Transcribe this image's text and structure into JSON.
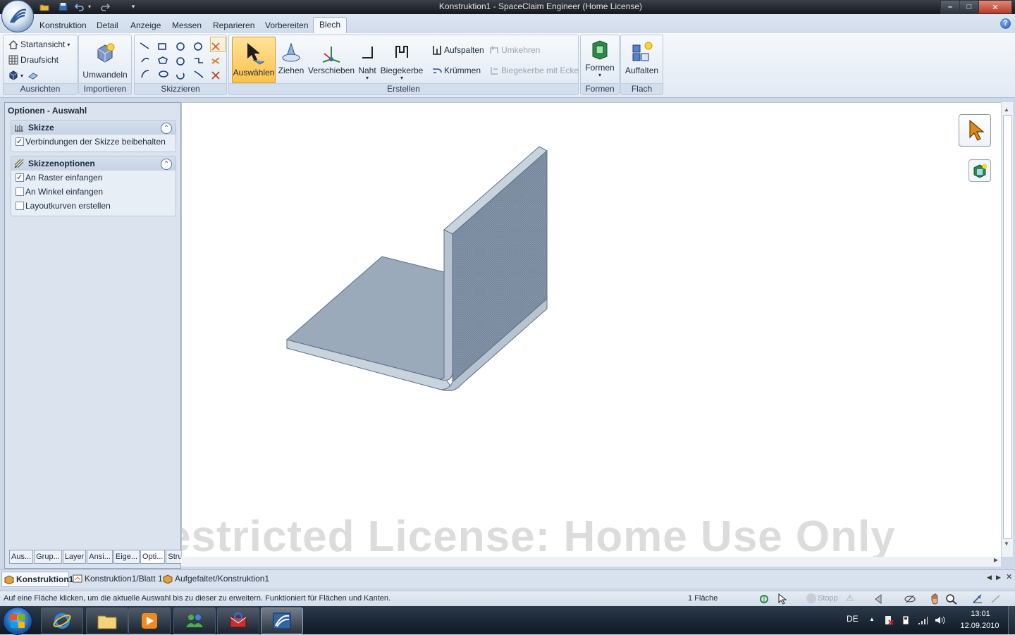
{
  "window": {
    "title": "Konstruktion1 - SpaceClaim Engineer (Home License)",
    "minimize": "–",
    "maximize": "□",
    "close": "✕"
  },
  "quick_access": [
    "open-icon",
    "save-icon",
    "undo-icon",
    "dropdown-icon",
    "redo-icon",
    "customize-icon"
  ],
  "ribbon_tabs": [
    {
      "label": "Konstruktion"
    },
    {
      "label": "Detail"
    },
    {
      "label": "Anzeige"
    },
    {
      "label": "Messen"
    },
    {
      "label": "Reparieren"
    },
    {
      "label": "Vorbereiten"
    },
    {
      "label": "Blech",
      "active": true
    }
  ],
  "help_label": "?",
  "ribbon": {
    "ausrichten": {
      "label": "Ausrichten",
      "startansicht": "Startansicht",
      "draufsicht": "Draufsicht"
    },
    "importieren": {
      "label": "Importieren",
      "umwandeln": "Umwandeln"
    },
    "skizzieren": {
      "label": "Skizzieren"
    },
    "erstellen": {
      "label": "Erstellen",
      "auswaehlen": "Auswählen",
      "ziehen": "Ziehen",
      "verschieben": "Verschieben",
      "naht": "Naht",
      "biegekerbe": "Biegekerbe",
      "aufspalten": "Aufspalten",
      "kruemmen": "Krümmen",
      "umkehren": "Umkehren",
      "biegekerbe_ecke": "Biegekerbe mit Ecke"
    },
    "formen": {
      "label": "Formen",
      "formen": "Formen"
    },
    "flach": {
      "label": "Flach",
      "auffalten": "Auffalten"
    }
  },
  "options_panel": {
    "title": "Optionen - Auswahl",
    "sections": [
      {
        "title": "Skizze",
        "items": [
          {
            "label": "Verbindungen der Skizze beibehalten",
            "checked": true
          }
        ]
      },
      {
        "title": "Skizzenoptionen",
        "items": [
          {
            "label": "An Raster einfangen",
            "checked": true
          },
          {
            "label": "An Winkel einfangen",
            "checked": false
          },
          {
            "label": "Layoutkurven erstellen",
            "checked": false
          }
        ]
      }
    ],
    "tabs": [
      "Aus...",
      "Grup...",
      "Layer",
      "Ansi...",
      "Eige...",
      "Opti...",
      "Stru..."
    ]
  },
  "viewport": {
    "watermark": "estricted License: Home Use Only",
    "part_fill": "#9aaabb",
    "edge": "#5d6f86"
  },
  "document_tabs": [
    {
      "label": "Konstruktion1",
      "active": true
    },
    {
      "label": "Konstruktion1/Blatt 1"
    },
    {
      "label": "Aufgefaltet/Konstruktion1"
    }
  ],
  "status": {
    "hint": "Auf eine Fläche klicken, um die aktuelle Auswahl bis zu dieser zu erweitern. Funktioniert für Flächen und Kanten.",
    "selection": "1 Fläche",
    "stop": "Stopp"
  },
  "taskbar": {
    "language": "DE",
    "time": "13:01",
    "date": "12.09.2010"
  }
}
